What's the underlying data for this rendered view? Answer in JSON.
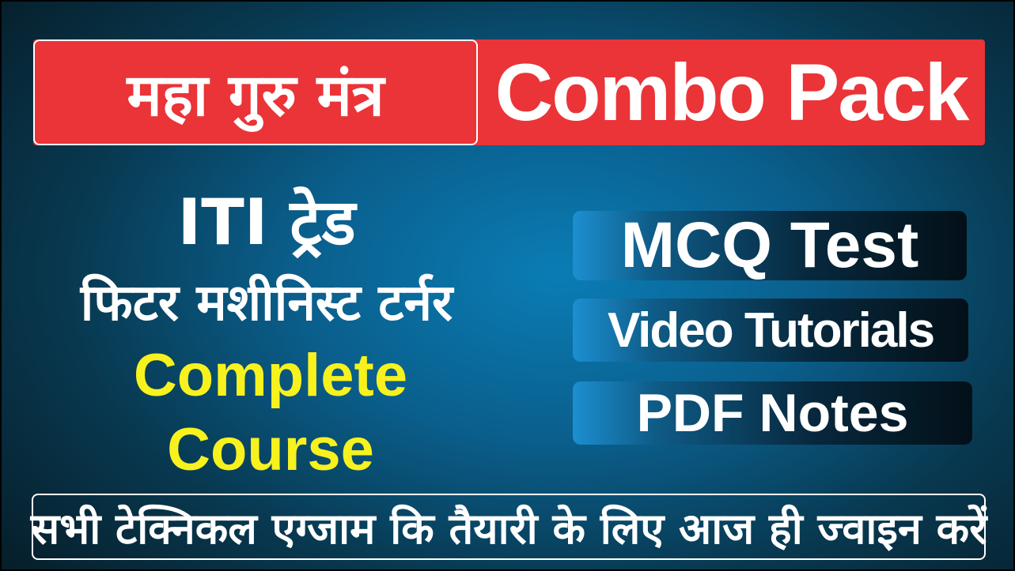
{
  "header": {
    "left_text": "महा गुरु मंत्र",
    "right_text": "Combo Pack"
  },
  "left": {
    "trade_title": "ITI ट्रेड",
    "trade_names": "फिटर मशीनिस्ट टर्नर",
    "course_line1": "Complete",
    "course_line2": "Course"
  },
  "features": [
    "MCQ Test",
    "Video Tutorials",
    "PDF Notes"
  ],
  "footer": {
    "text": "सभी टेक्निकल एग्जाम कि तैयारी के लिए आज ही ज्वाइन करें"
  },
  "colors": {
    "header_red": "#ea3438",
    "highlight_yellow": "#f7f21e",
    "background_blue": "#0a7db5"
  }
}
